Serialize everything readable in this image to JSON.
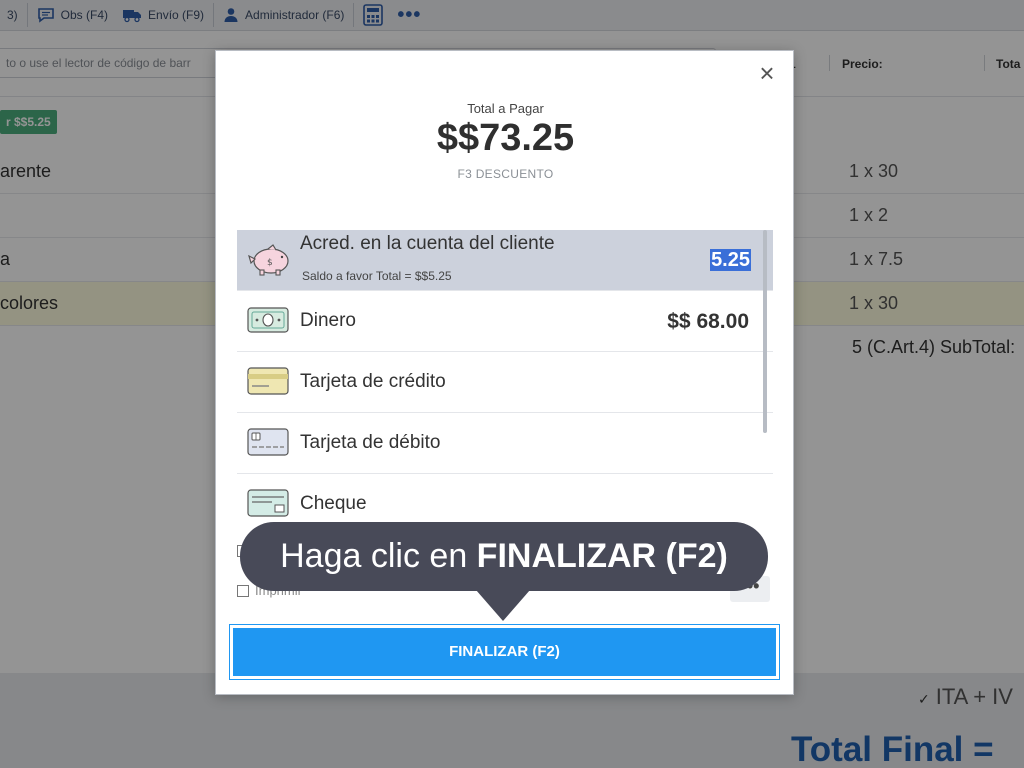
{
  "toolbar": {
    "items": [
      {
        "label": "3)",
        "icon": "key-shortcut"
      },
      {
        "label": "Obs (F4)",
        "icon": "comment-icon"
      },
      {
        "label": "Envío (F9)",
        "icon": "truck-icon"
      },
      {
        "label": "Administrador (F6)",
        "icon": "user-icon"
      }
    ],
    "calculator_icon": "calculator-icon",
    "more_label": "•••"
  },
  "search": {
    "placeholder": "to o use el lector de código de barr"
  },
  "columns": {
    "qty_fragment": "1",
    "price": "Precio:",
    "total": "Tota"
  },
  "balance_badge": "r $$5.25",
  "rows": [
    {
      "desc": "arente",
      "qty": "1 x 30"
    },
    {
      "desc": "",
      "qty": "1 x 2"
    },
    {
      "desc": "a",
      "qty": "1 x 7.5"
    },
    {
      "desc": " colores",
      "qty": "1 x 30"
    }
  ],
  "subtotal": "5 (C.Art.4) SubTotal:",
  "footer": {
    "tax_check": "✓",
    "tax_label": "ITA + IV",
    "total_final": "Total Final = "
  },
  "modal": {
    "total_label": "Total a Pagar",
    "total_value": "$$73.25",
    "discount_link": "F3 DESCUENTO",
    "close_glyph": "×",
    "methods": [
      {
        "name": "Acred. en la cuenta del cliente",
        "sub": "Saldo a favor Total = $$5.25",
        "input_value": "5.25",
        "icon": "piggy-bank-icon"
      },
      {
        "name": "Dinero",
        "amount": "$$ 68.00",
        "icon": "cash-icon"
      },
      {
        "name": "Tarjeta de crédito",
        "icon": "credit-card-icon"
      },
      {
        "name": "Tarjeta de débito",
        "icon": "debit-card-icon"
      },
      {
        "name": "Cheque",
        "icon": "cheque-icon"
      }
    ],
    "option_print": "Imprimir",
    "more_label": "•••",
    "finalize_label": "FINALIZAR (F2)"
  },
  "tooltip": {
    "prefix": "Haga clic en ",
    "bold": "FINALIZAR (F2)"
  },
  "colors": {
    "accent": "#1f97f2",
    "tooltip_bg": "#484a58",
    "selected_row": "#ccd1dc",
    "balance_badge": "#4caf7f",
    "total_final": "#1f5fae"
  }
}
